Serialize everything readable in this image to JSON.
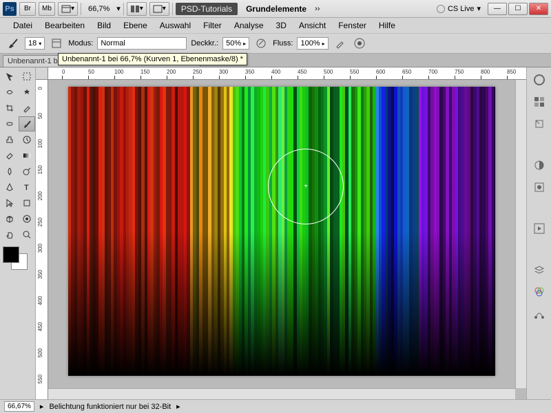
{
  "titlebar": {
    "zoom": "66,7%",
    "workspace": "PSD-Tutorials",
    "workspace2": "Grundelemente",
    "cslive": "CS Live"
  },
  "menu": {
    "datei": "Datei",
    "bearbeiten": "Bearbeiten",
    "bild": "Bild",
    "ebene": "Ebene",
    "auswahl": "Auswahl",
    "filter": "Filter",
    "analyse": "Analyse",
    "dreid": "3D",
    "ansicht": "Ansicht",
    "fenster": "Fenster",
    "hilfe": "Hilfe"
  },
  "options": {
    "brush_size": "18",
    "modus_label": "Modus:",
    "modus_value": "Normal",
    "deckk_label": "Deckkr.:",
    "deckk_value": "50%",
    "fluss_label": "Fluss:",
    "fluss_value": "100%"
  },
  "tooltip": "Unbenannt-1 bei 66,7% (Kurven 1, Ebenenmaske/8) *",
  "tab": {
    "title": "Unbenannt-1 bei 66,7% (Kurven 1, Ebenenmaske/8) *"
  },
  "ruler_h": [
    "0",
    "50",
    "100",
    "150",
    "200",
    "250",
    "300",
    "350",
    "400",
    "450",
    "500",
    "550",
    "600",
    "650",
    "700",
    "750",
    "800",
    "850"
  ],
  "ruler_v": [
    "0",
    "50",
    "100",
    "150",
    "200",
    "250",
    "300",
    "350",
    "400",
    "450",
    "500",
    "550"
  ],
  "status": {
    "zoom": "66,67%",
    "msg": "Belichtung funktioniert nur bei 32-Bit"
  }
}
